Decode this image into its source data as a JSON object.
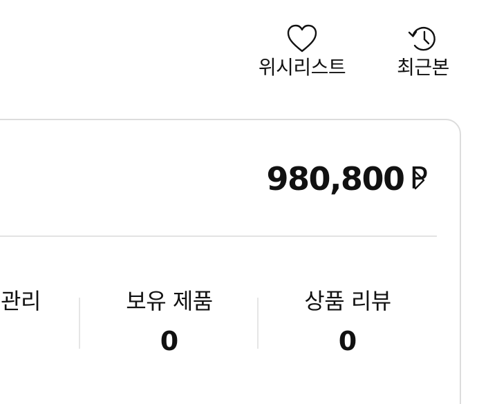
{
  "header": {
    "wishlist": {
      "label": "위시리스트",
      "icon": "heart-icon"
    },
    "recent": {
      "label": "최근본",
      "icon": "history-icon"
    }
  },
  "card": {
    "points": {
      "value": "980,800",
      "unit": "P",
      "chevron_icon": "chevron-right-icon"
    },
    "stats": [
      {
        "label": "관리",
        "value": ""
      },
      {
        "label": "보유 제품",
        "value": "0"
      },
      {
        "label": "상품 리뷰",
        "value": "0"
      }
    ]
  },
  "colors": {
    "border": "#dcdcdc",
    "divider": "#e3e3e3",
    "text": "#111111"
  }
}
